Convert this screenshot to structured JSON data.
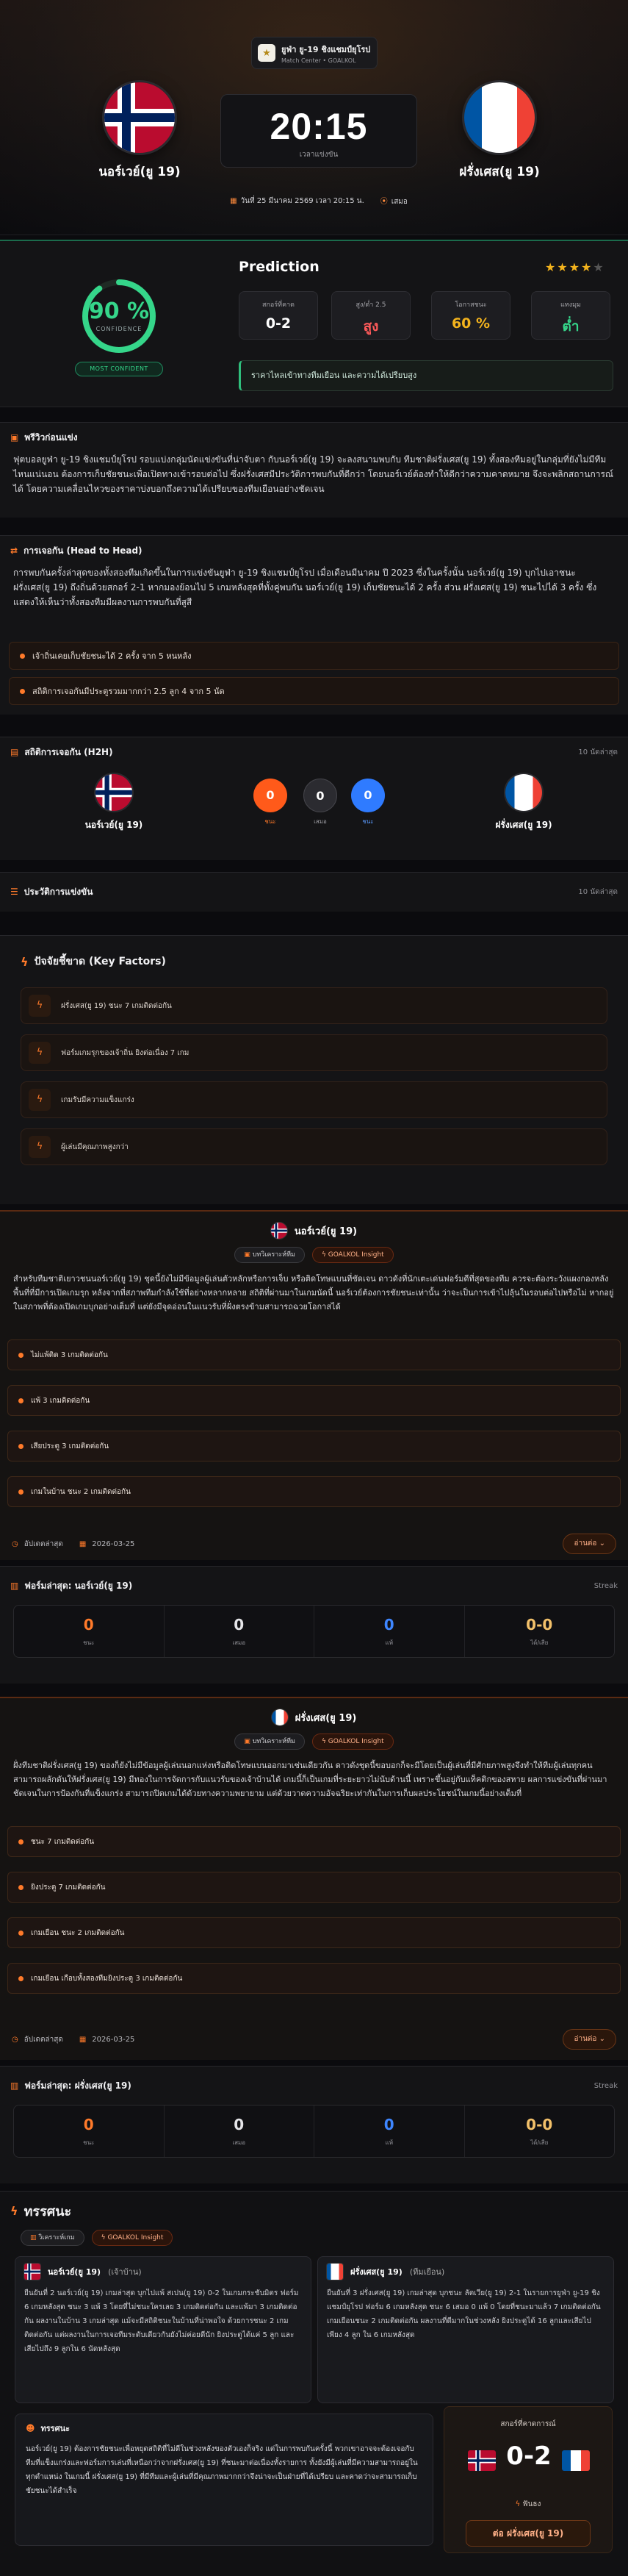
{
  "league": {
    "name": "ยูฟ่า ยู-19 ชิงแชมป์ยุโรป",
    "sub": "Match Center • GOALKOL"
  },
  "home": {
    "name": "นอร์เวย์(ยู 19)"
  },
  "away": {
    "name": "ฝรั่งเศส(ยู 19)"
  },
  "match": {
    "time": "20:15",
    "time_sub": "เวลาแข่งขัน",
    "date": "วันที่ 25 มีนาคม 2569 เวลา 20:15 น.",
    "venue": "เสมอ"
  },
  "prediction": {
    "title": "Prediction",
    "confidence_pct": "90 %",
    "confidence_label": "CONFIDENCE",
    "confidence_badge": "MOST CONFIDENT",
    "stars": 4,
    "cards": [
      {
        "label": "สกอร์ที่คาด",
        "value": "0-2",
        "color": "#ffffff"
      },
      {
        "label": "สูง/ต่ำ 2.5",
        "value": "สูง",
        "color": "#ff5a5a"
      },
      {
        "label": "โอกาสชนะ",
        "value": "60 %",
        "color": "#f3b31d"
      },
      {
        "label": "แทงมุม",
        "value": "ต่ำ",
        "color": "#35d68a"
      }
    ],
    "note": "ราคาไหลเข้าทางทีมเยือน และความได้เปรียบสูง"
  },
  "preview": {
    "title": "พรีวิวก่อนแข่ง",
    "text": "ฟุตบอลยูฟ่า ยู-19 ชิงแชมป์ยุโรป รอบแบ่งกลุ่มนัดแข่งขันที่น่าจับตา กับนอร์เวย์(ยู 19) จะลงสนามพบกับ ทีมชาติฝรั่งเศส(ยู 19) ทั้งสองทีมอยู่ในกลุ่มที่ยังไม่มีทีมไหนแน่นอน ต้องการเก็บชัยชนะเพื่อเปิดทางเข้ารอบต่อไป ซึ่งฝรั่งเศสมีประวัติการพบกันที่ดีกว่า โดยนอร์เวย์ต้องทำให้ดีกว่าความคาดหมาย จึงจะพลิกสถานการณ์ได้ โดยความเคลื่อนไหวของราคาบ่งบอกถึงความได้เปรียบของทีมเยือนอย่างชัดเจน"
  },
  "h2h_analysis": {
    "title": "การเจอกัน (Head to Head)",
    "text": "การพบกันครั้งล่าสุดของทั้งสองทีมเกิดขึ้นในการแข่งขันยูฟ่า ยู-19 ชิงแชมป์ยุโรป เมื่อเดือนมีนาคม ปี 2023 ซึ่งในครั้งนั้น นอร์เวย์(ยู 19) บุกไปเอาชนะ ฝรั่งเศส(ยู 19) ถึงถิ่นด้วยสกอร์ 2-1 หากมองย้อนไป 5 เกมหลังสุดที่ทั้งคู่พบกัน นอร์เวย์(ยู 19) เก็บชัยชนะได้ 2 ครั้ง ส่วน ฝรั่งเศส(ยู 19) ชนะไปได้ 3 ครั้ง ซึ่งแสดงให้เห็นว่าทั้งสองทีมมีผลงานการพบกันที่สูสี",
    "bullets": [
      "เจ้าถิ่นเคยเก็บชัยชนะได้ 2 ครั้ง จาก 5 หนหลัง",
      "สถิติการเจอกันมีประตูรวมมากกว่า 2.5 ลูก 4 จาก 5 นัด"
    ]
  },
  "h2h_stats": {
    "title": "สถิติการเจอกัน (H2H)",
    "right": "10 นัดล่าสุด",
    "home_wins": "0",
    "home_label": "ชนะ",
    "draws": "0",
    "draw_label": "เสมอ",
    "away_wins": "0",
    "away_label": "ชนะ"
  },
  "history": {
    "title": "ประวัติการแข่งขัน",
    "right": "10 นัดล่าสุด"
  },
  "key_factors": {
    "title": "ปัจจัยชี้ขาด (Key Factors)",
    "items": [
      "ฝรั่งเศส(ยู 19) ชนะ 7 เกมติดต่อกัน",
      "ฟอร์มเกมรุกของเจ้าถิ่น ยิงต่อเนื่อง 7 เกม",
      "เกมรับมีความแข็งแกร่ง",
      "ผู้เล่นมีคุณภาพสูงกว่า"
    ]
  },
  "home_analysis": {
    "name": "นอร์เวย์(ยู 19)",
    "pill1": "บทวิเคราะห์ทีม",
    "pill2": "GOALKOL Insight",
    "text": "สำหรับทีมชาติเยาวชนนอร์เวย์(ยู 19) ชุดนี้ยังไม่มีข้อมูลผู้เล่นตัวหลักหรือการเจ็บ หรือติดโทษแบนที่ชัดเจน ดาวดังที่นักเตะเด่นฟอร์มดีที่สุดของทีม ควรจะต้องระวังแผงกองหลังพื้นที่ที่มีการเปิดเกมรุก หลังจากที่สภาพทีมกำลังใช้ที่อย่างหลากหลาย สถิติที่ผ่านมาในเกมนัดนี้ นอร์เวย์ต้องการชัยชนะเท่านั้น ว่าจะเป็นการเข้าไปลุ้นในรอบต่อไปหรือไม่ หากอยู่ในสภาพที่ต้องเปิดเกมบุกอย่างเต็มที่ แต่ยังมีจุดอ่อนในแนวรับที่ฝั่งตรงข้ามสามารถฉวยโอกาสได้",
    "bullets": [
      "ไม่แพ้ติด 3 เกมติดต่อกัน",
      "แพ้ 3 เกมติดต่อกัน",
      "เสียประตู 3 เกมติดต่อกัน",
      "เกมในบ้าน ชนะ 2 เกมติดต่อกัน"
    ],
    "updated_label": "อัปเดตล่าสุด",
    "updated": "2026-03-25",
    "button": "อ่านต่อ"
  },
  "home_form": {
    "title": "ฟอร์มล่าสุด: นอร์เวย์(ยู 19)",
    "right": "Streak",
    "win": "0",
    "win_l": "ชนะ",
    "draw": "0",
    "draw_l": "เสมอ",
    "loss": "0",
    "loss_l": "แพ้",
    "gd": "0-0",
    "gd_l": "ได้/เสีย"
  },
  "away_analysis": {
    "name": "ฝรั่งเศส(ยู 19)",
    "pill1": "บทวิเคราะห์ทีม",
    "pill2": "GOALKOL Insight",
    "text": "ฝั่งทีมชาติฝรั่งเศส(ยู 19) ของก็ยังไม่มีข้อมูลผู้เล่นนอกแห่งหรือติดโทษแบนออกมาเช่นเดียวกัน ดาวดังชุดนี้ขอบอกก็จะมีโดยเป็นผู้เล่นที่มีศักยภาพสูงจึงทำให้ทีมผู้เล่นทุกคนสามารถผลักดันให้ฝรั่งเศส(ยู 19) มีทองในการจัดการกับแนวรับของเจ้าบ้านได้ เกมนี้ก็เป็นเกมที่ระยะยาวไม่นับด้านนี้ เพราะขึ้นอยู่กับแท็คติกของสหาย ผลการแข่งขันที่ผ่านมาชัดเจนในการป้องกันที่แข็งแกร่ง สามารถปิดเกมได้ด้วยทางความพยายาม แต่ด้วยวาดความอัจฉริยะเท่ากันในการเก็บผลประโยชน์ในเกมนี้อย่างเต็มที่",
    "bullets": [
      "ชนะ 7 เกมติดต่อกัน",
      "ยิงประตู 7 เกมติดต่อกัน",
      "เกมเยือน ชนะ 2 เกมติดต่อกัน",
      "เกมเยือน เกือบทั้งสองทีมยิงประตู 3 เกมติดต่อกัน"
    ],
    "updated_label": "อัปเดตล่าสุด",
    "updated": "2026-03-25",
    "button": "อ่านต่อ"
  },
  "away_form": {
    "title": "ฟอร์มล่าสุด: ฝรั่งเศส(ยู 19)",
    "right": "Streak",
    "win": "0",
    "win_l": "ชนะ",
    "draw": "0",
    "draw_l": "เสมอ",
    "loss": "0",
    "loss_l": "แพ้",
    "gd": "0-0",
    "gd_l": "ได้/เสีย"
  },
  "insight": {
    "title": "ทรรศนะ",
    "pill1": "วิเคราะห์เกม",
    "pill2": "GOALKOL Insight",
    "home_card": {
      "name": "นอร์เวย์(ยู 19)",
      "tag": "(เจ้าบ้าน)",
      "text": "ยืนยันที่ 2 นอร์เวย์(ยู 19) เกมล่าสุด บุกไปแพ้ สเปน(ยู 19) 0-2 ในเกมกระชับมิตร ฟอร์ม 6 เกมหลังสุด ชนะ 3 แพ้ 3 โดยที่ไม่ชนะใครเลย 3 เกมติดต่อกัน และแพ้มา 3 เกมติดต่อกัน ผลงานในบ้าน 3 เกมล่าสุด แม้จะมีสถิติชนะในบ้านที่น่าพอใจ ด้วยการชนะ 2 เกมติดต่อกัน แต่ผลงานในการเจอทีมระดับเดียวกันยังไม่ค่อยดีนัก ยิงประตูได้แค่ 5 ลูก และเสียไปถึง 9 ลูกใน 6 นัดหลังสุด"
    },
    "away_card": {
      "name": "ฝรั่งเศส(ยู 19)",
      "tag": "(ทีมเยือน)",
      "text": "ยืนยันที่ 3 ฝรั่งเศส(ยู 19) เกมล่าสุด บุกชนะ ลัตเวีย(ยู 19) 2-1 ในรายการยูฟ่า ยู-19 ชิงแชมป์ยุโรป ฟอร์ม 6 เกมหลังสุด ชนะ 6 เสมอ 0 แพ้ 0 โดยที่ชนะมาแล้ว 7 เกมติดต่อกัน เกมเยือนชนะ 2 เกมติดต่อกัน ผลงานที่ดีมากในช่วงหลัง ยิงประตูได้ 16 ลูกและเสียไปเพียง 4 ลูก ใน 6 เกมหลังสุด"
    },
    "summary_title": "ทรรศนะ",
    "summary": "นอร์เวย์(ยู 19) ต้องการชัยชนะเพื่อหยุดสถิติที่ไม่ดีในช่วงหลังของตัวเองก็จริง แต่ในการพบกันครั้งนี้ พวกเขาอาจจะต้องเจอกับทีมที่แข็งแกร่งและฟอร์มการเล่นที่เหนือกว่าจากฝรั่งเศส(ยู 19) ที่ชนะมาต่อเนื่องทั้งรายการ ทั้งยังมีผู้เล่นที่มีความสามารถอยู่ในทุกตำแหน่ง ในเกมนี้ ฝรั่งเศส(ยู 19) ที่มีทีมและผู้เล่นที่มีคุณภาพมากกว่าจึงน่าจะเป็นฝ่ายที่ได้เปรียบ และคาดว่าจะสามารถเก็บชัยชนะได้สำเร็จ",
    "final_label": "สกอร์ที่คาดการณ์",
    "final_score": "0-2",
    "final_pick_label": "ฟันธง",
    "final_pick": "ต่อ ฝรั่งเศส(ยู 19)"
  },
  "colors": {
    "accent": "#ff7a2a",
    "green": "#35d68a",
    "home_bubble": "#ff5a1a",
    "away_bubble": "#2f7bff"
  }
}
